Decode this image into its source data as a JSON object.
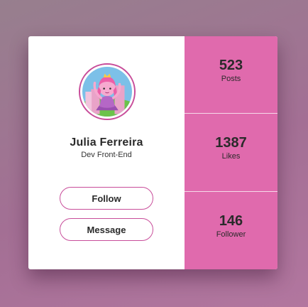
{
  "profile": {
    "name": "Julia Ferreira",
    "role": "Dev Front-End",
    "avatar_alt": "princess-bubblegum-avatar"
  },
  "actions": {
    "follow_label": "Follow",
    "message_label": "Message"
  },
  "stats": [
    {
      "value": "523",
      "label": "Posts"
    },
    {
      "value": "1387",
      "label": "Likes"
    },
    {
      "value": "146",
      "label": "Follower"
    }
  ],
  "colors": {
    "accent": "#e06aad",
    "border": "#c84d9a",
    "background": "#a36f94"
  }
}
